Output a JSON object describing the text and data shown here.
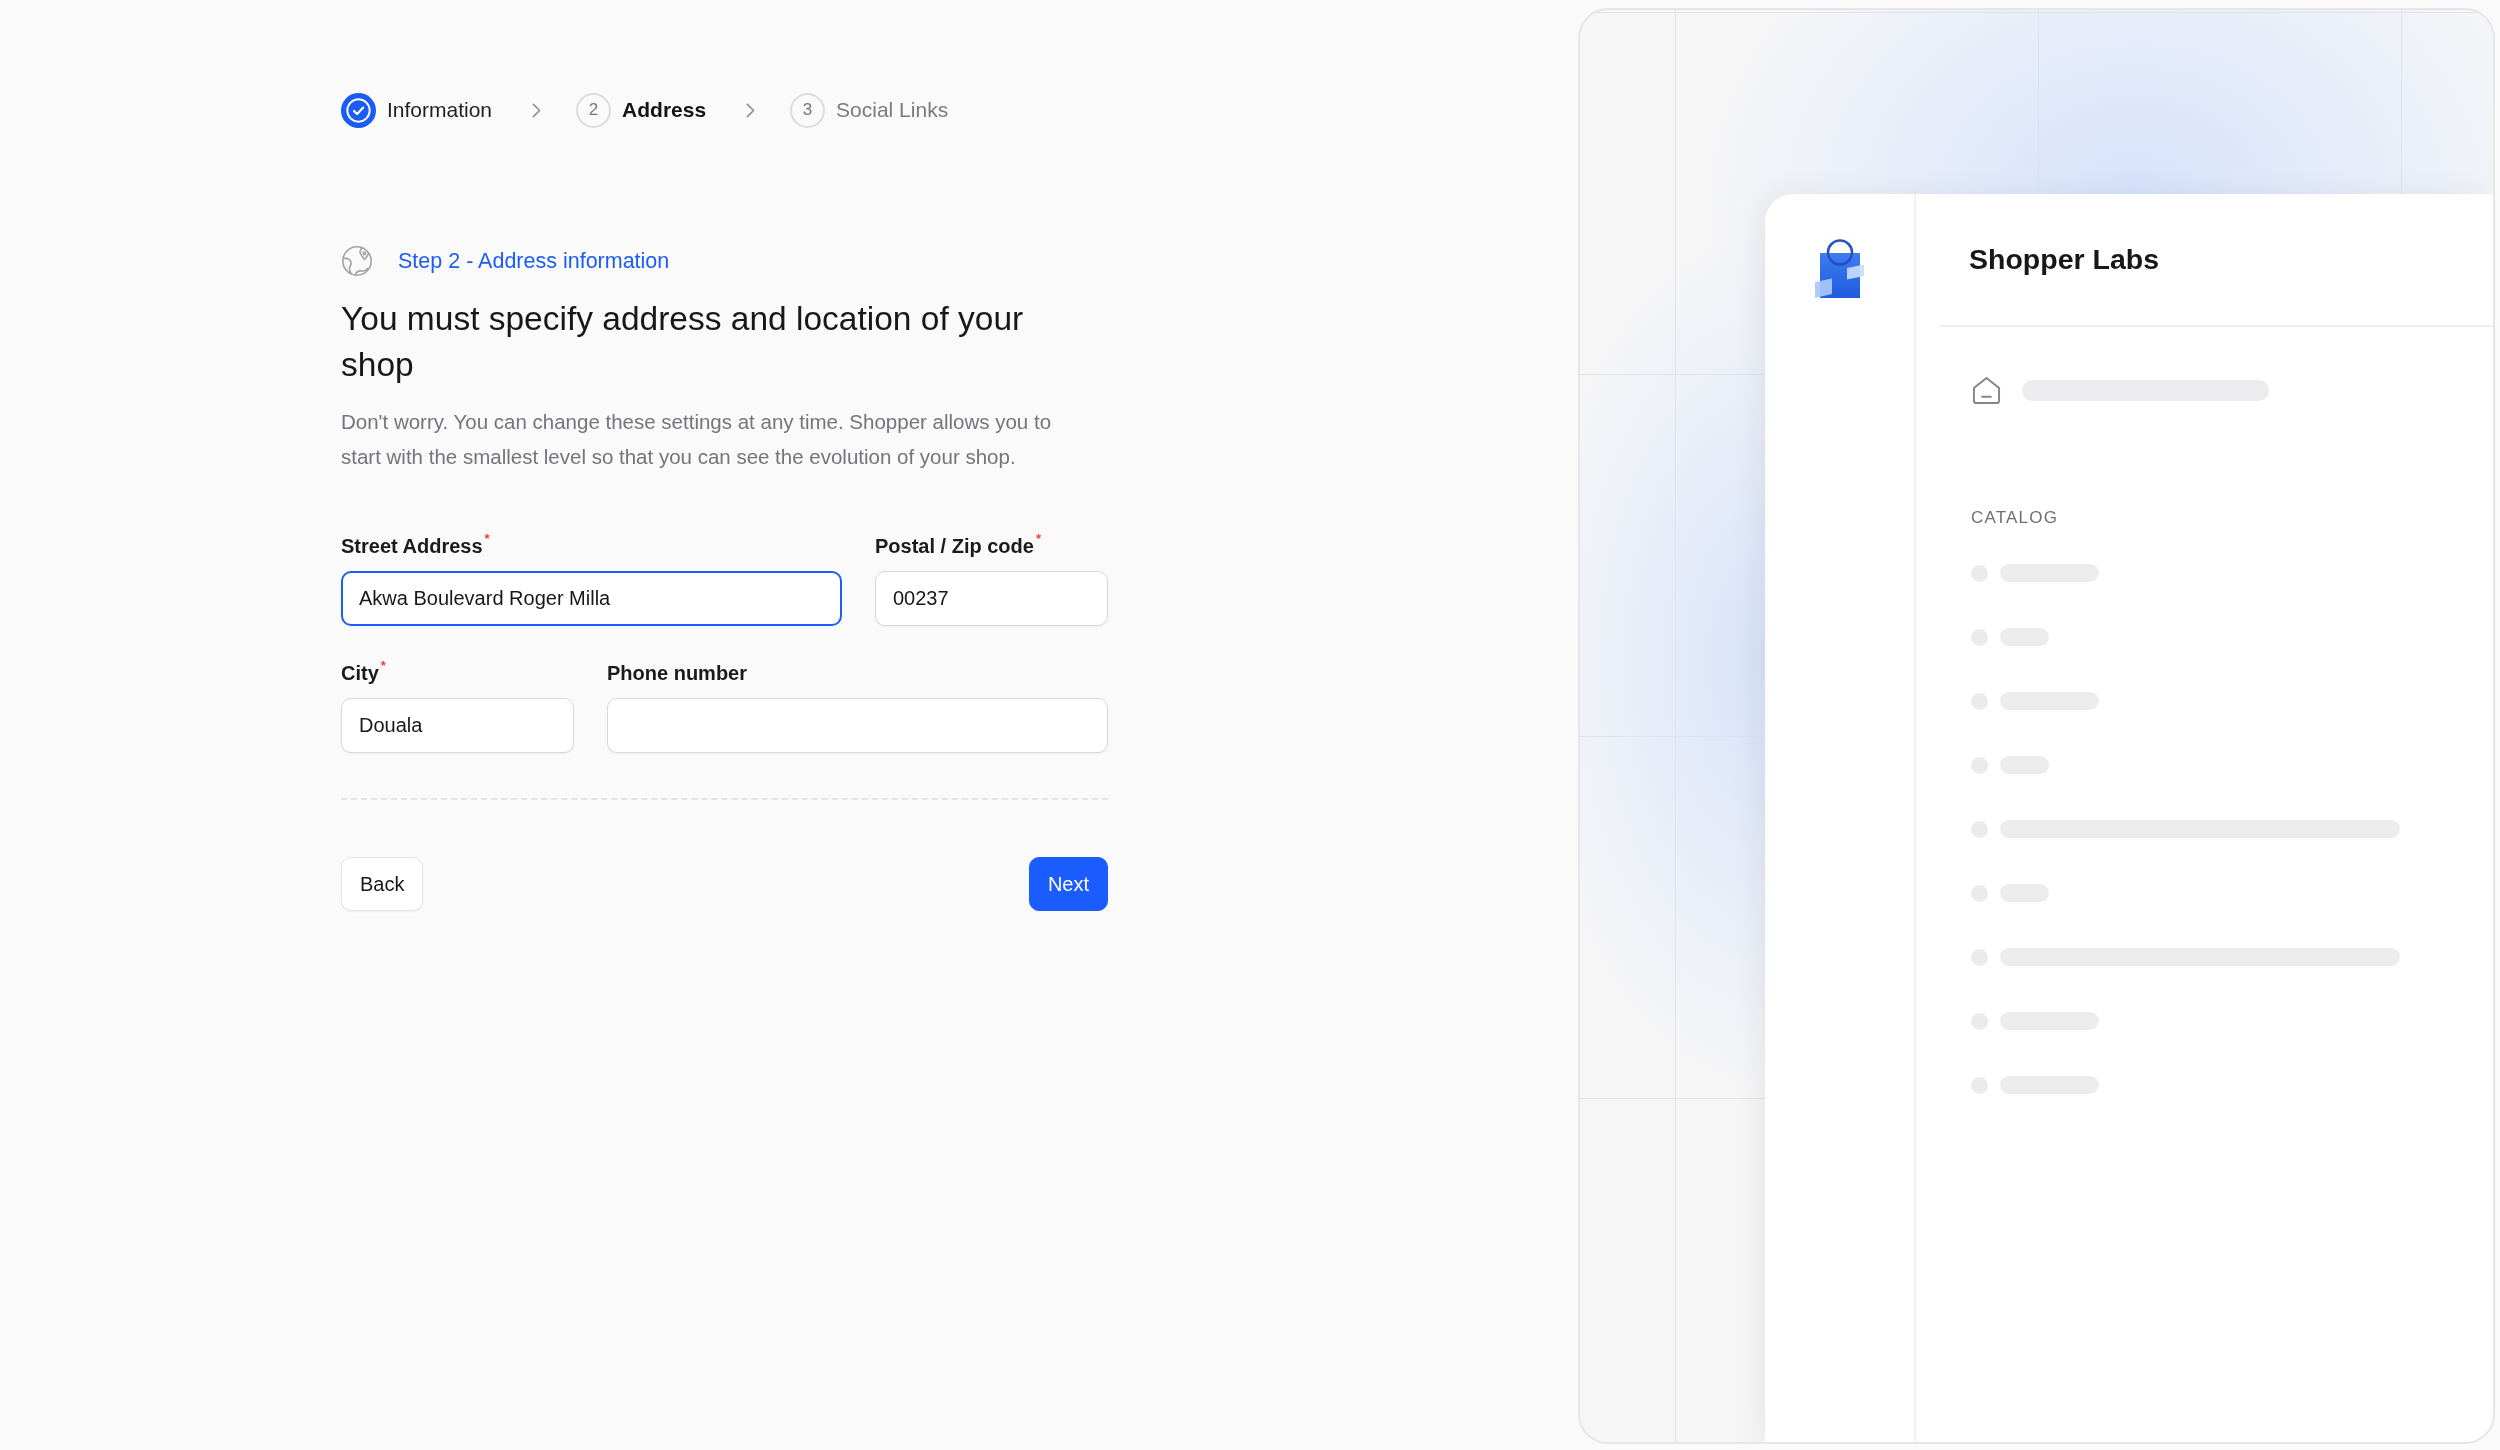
{
  "stepper": {
    "steps": [
      {
        "label": "Information",
        "completed": true,
        "selected": false
      },
      {
        "number": "2",
        "label": "Address",
        "completed": false,
        "selected": true
      },
      {
        "number": "3",
        "label": "Social Links",
        "completed": false,
        "selected": false
      }
    ]
  },
  "step_heading": "Step 2 - Address information",
  "title": "You must specify address and location of your shop",
  "description": "Don't worry. You can change these settings at any time. Shopper allows you to start with the smallest level so that you can see the evolution of your shop.",
  "form": {
    "fields": [
      {
        "label": "Street Address",
        "required_mark": "*",
        "value": "Akwa Boulevard Roger Milla",
        "focused": true
      },
      {
        "label": "Postal / Zip code",
        "required_mark": "*",
        "value": "00237",
        "focused": false
      },
      {
        "label": "City",
        "required_mark": "*",
        "value": "Douala",
        "focused": false
      },
      {
        "label": "Phone number",
        "focused": false
      }
    ]
  },
  "buttons": [
    {
      "label": "Back",
      "kind": "secondary"
    },
    {
      "label": "Next",
      "kind": "primary"
    }
  ],
  "preview": {
    "brand": "Shopper Labs",
    "nav_items": [
      {
        "kind": "home"
      }
    ],
    "section": {
      "title": "CATALOG",
      "items": [
        {
          "kind": "medium"
        },
        {
          "kind": "short"
        },
        {
          "kind": "medium"
        },
        {
          "kind": "short"
        },
        {
          "kind": "long"
        },
        {
          "kind": "short"
        },
        {
          "kind": "long"
        },
        {
          "kind": "medium"
        },
        {
          "kind": "medium"
        }
      ]
    }
  }
}
